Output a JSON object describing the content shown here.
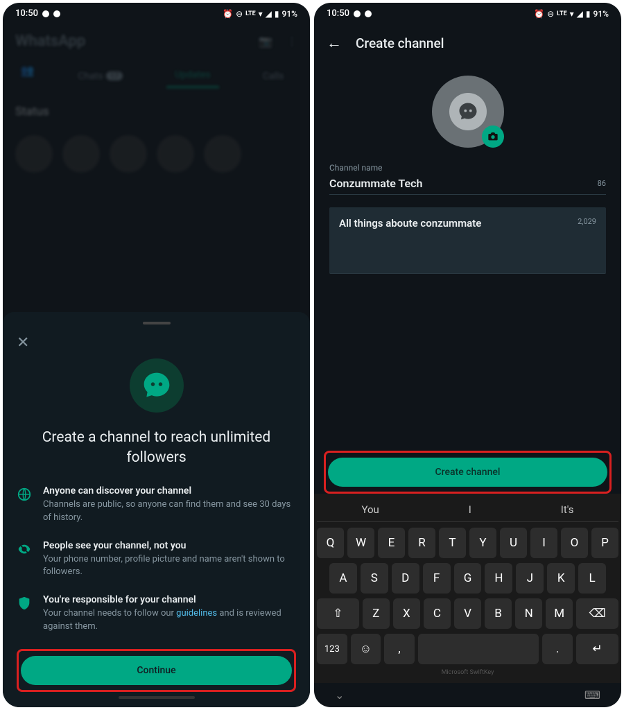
{
  "statusBar": {
    "time": "10:50",
    "battery": "91%",
    "lte": "LTE"
  },
  "left": {
    "appTitle": "WhatsApp",
    "tabs": {
      "chats": "Chats",
      "chatsBadge": "17",
      "updates": "Updates",
      "calls": "Calls"
    },
    "statusLabel": "Status",
    "sheet": {
      "title": "Create a channel to reach unlimited followers",
      "item1": {
        "title": "Anyone can discover your channel",
        "body": "Channels are public, so anyone can find them and see 30 days of history."
      },
      "item2": {
        "title": "People see your channel, not you",
        "body": "Your phone number, profile picture and name aren't shown to followers."
      },
      "item3": {
        "title": "You're responsible for your channel",
        "body1": "Your channel needs to follow our ",
        "link": "guidelines",
        "body2": " and is reviewed against them."
      },
      "continueBtn": "Continue"
    }
  },
  "right": {
    "headerTitle": "Create channel",
    "nameLabel": "Channel name",
    "nameValue": "Conzummate Tech",
    "nameCount": "86",
    "descValue": "All things aboute conzummate",
    "descCount": "2,029",
    "createBtn": "Create channel",
    "suggestions": [
      "You",
      "I",
      "It's"
    ],
    "keyboard": {
      "row1": [
        "Q",
        "W",
        "E",
        "R",
        "T",
        "Y",
        "U",
        "I",
        "O",
        "P"
      ],
      "row2": [
        "A",
        "S",
        "D",
        "F",
        "G",
        "H",
        "J",
        "K",
        "L"
      ],
      "row3": [
        "Z",
        "X",
        "C",
        "V",
        "B",
        "N",
        "M"
      ],
      "numKey": "123",
      "brand": "Microsoft SwiftKey"
    }
  }
}
